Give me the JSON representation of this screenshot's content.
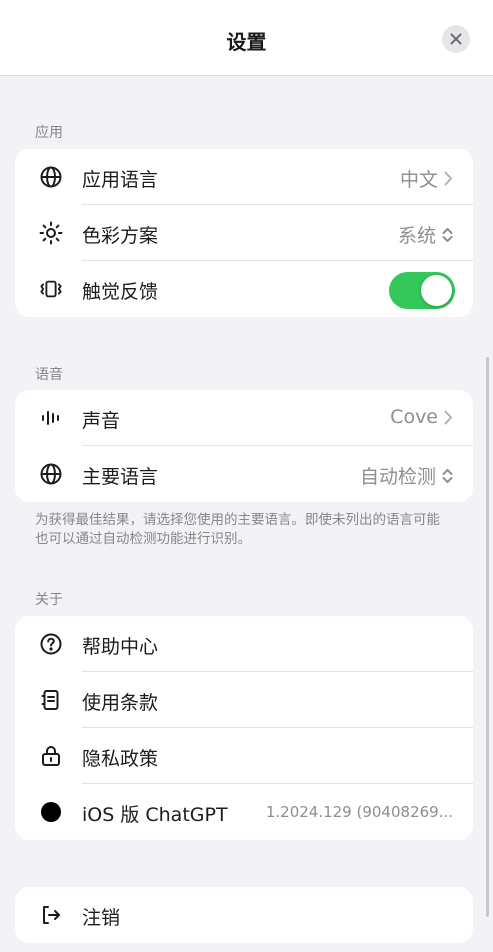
{
  "header": {
    "title": "设置"
  },
  "sections": {
    "app": {
      "label": "应用",
      "rows": {
        "language": {
          "label": "应用语言",
          "value": "中文",
          "icon": "globe-icon"
        },
        "color_scheme": {
          "label": "色彩方案",
          "value": "系统",
          "icon": "sun-icon"
        },
        "haptics": {
          "label": "触觉反馈",
          "enabled": true,
          "icon": "vibration-icon"
        }
      }
    },
    "speech": {
      "label": "语音",
      "rows": {
        "voice": {
          "label": "声音",
          "value": "Cove",
          "icon": "waveform-icon"
        },
        "main_language": {
          "label": "主要语言",
          "value": "自动检测",
          "icon": "globe-icon"
        }
      },
      "footnote": "为获得最佳结果，请选择您使用的主要语言。即使未列出的语言可能也可以通过自动检测功能进行识别。"
    },
    "about": {
      "label": "关于",
      "rows": {
        "help": {
          "label": "帮助中心",
          "icon": "question-circle-icon"
        },
        "terms": {
          "label": "使用条款",
          "icon": "document-icon"
        },
        "privacy": {
          "label": "隐私政策",
          "icon": "lock-icon"
        },
        "version": {
          "label": "iOS 版 ChatGPT",
          "value": "1.2024.129 (90408269...",
          "icon": "chatgpt-logo-icon"
        }
      }
    },
    "account": {
      "rows": {
        "logout": {
          "label": "注销",
          "icon": "logout-icon"
        }
      }
    }
  },
  "colors": {
    "toggle_on": "#34c759",
    "background": "#f2f2f7",
    "secondary_text": "#8e8e93"
  }
}
